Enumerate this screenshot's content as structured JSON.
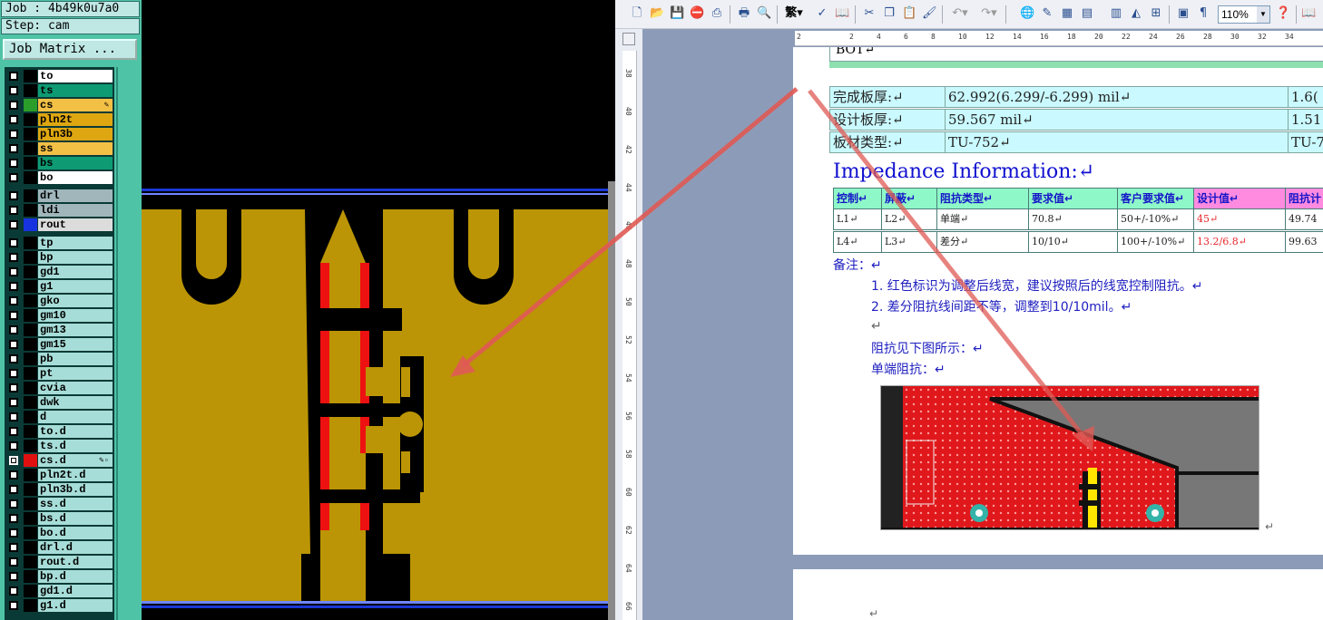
{
  "cam": {
    "job_label": "Job : 4b49k0u7a0",
    "step_label": "Step: cam",
    "job_matrix_button": "Job Matrix ...",
    "layers_group1": [
      {
        "name": "to",
        "color": "#ffffff",
        "swatch": "#000000",
        "checked": false
      },
      {
        "name": "ts",
        "color": "#0e9b74",
        "swatch": "#000000",
        "checked": false
      },
      {
        "name": "cs",
        "color": "#f3c046",
        "swatch": "#2a9d2a",
        "checked": false,
        "marker": "✎"
      },
      {
        "name": "pln2t",
        "color": "#dea712",
        "swatch": "#000000",
        "checked": false
      },
      {
        "name": "pln3b",
        "color": "#dea712",
        "swatch": "#000000",
        "checked": false
      },
      {
        "name": "ss",
        "color": "#f3c046",
        "swatch": "#000000",
        "checked": false
      },
      {
        "name": "bs",
        "color": "#0e9b74",
        "swatch": "#000000",
        "checked": false
      },
      {
        "name": "bo",
        "color": "#ffffff",
        "swatch": "#000000",
        "checked": false
      }
    ],
    "layers_group2": [
      {
        "name": "drl",
        "color": "#a0b6bb",
        "swatch": "#000000",
        "checked": false
      },
      {
        "name": "ldi",
        "color": "#a0b6bb",
        "swatch": "#000000",
        "checked": false
      },
      {
        "name": "rout",
        "color": "#dcdcdc",
        "swatch": "#1733e0",
        "checked": false
      }
    ],
    "layers_group3": [
      {
        "name": "tp",
        "swatch": "#000000",
        "checked": false
      },
      {
        "name": "bp",
        "swatch": "#000000",
        "checked": false
      },
      {
        "name": "gd1",
        "swatch": "#000000",
        "checked": false
      },
      {
        "name": "g1",
        "swatch": "#000000",
        "checked": false
      },
      {
        "name": "gko",
        "swatch": "#000000",
        "checked": false
      },
      {
        "name": "gm10",
        "swatch": "#000000",
        "checked": false
      },
      {
        "name": "gm13",
        "swatch": "#000000",
        "checked": false
      },
      {
        "name": "gm15",
        "swatch": "#000000",
        "checked": false
      },
      {
        "name": "pb",
        "swatch": "#000000",
        "checked": false
      },
      {
        "name": "pt",
        "swatch": "#000000",
        "checked": false
      },
      {
        "name": "cvia",
        "swatch": "#000000",
        "checked": false
      },
      {
        "name": "dwk",
        "swatch": "#000000",
        "checked": false
      },
      {
        "name": "d",
        "swatch": "#000000",
        "checked": false
      },
      {
        "name": "to.d",
        "swatch": "#000000",
        "checked": false
      },
      {
        "name": "ts.d",
        "swatch": "#000000",
        "checked": false
      },
      {
        "name": "cs.d",
        "swatch": "#e01010",
        "checked": true,
        "marker": "✎▫"
      },
      {
        "name": "pln2t.d",
        "swatch": "#000000",
        "checked": false
      },
      {
        "name": "pln3b.d",
        "swatch": "#000000",
        "checked": false
      },
      {
        "name": "ss.d",
        "swatch": "#000000",
        "checked": false
      },
      {
        "name": "bs.d",
        "swatch": "#000000",
        "checked": false
      },
      {
        "name": "bo.d",
        "swatch": "#000000",
        "checked": false
      },
      {
        "name": "drl.d",
        "swatch": "#000000",
        "checked": false
      },
      {
        "name": "rout.d",
        "swatch": "#000000",
        "checked": false
      },
      {
        "name": "bp.d",
        "swatch": "#000000",
        "checked": false
      },
      {
        "name": "gd1.d",
        "swatch": "#000000",
        "checked": false
      },
      {
        "name": "g1.d",
        "swatch": "#000000",
        "checked": false
      }
    ],
    "colors": {
      "copper": "#bb9505",
      "trace_edge": "#ee1111",
      "board_edge": "#1a38d6"
    }
  },
  "word": {
    "zoom": "110%",
    "ruler_marks": [
      "2",
      "2",
      "4",
      "6",
      "8",
      "10",
      "12",
      "14",
      "16",
      "18",
      "20",
      "22",
      "24",
      "26",
      "28",
      "30",
      "32",
      "34"
    ],
    "vruler_marks": [
      "38",
      "40",
      "42",
      "44",
      "46",
      "48",
      "50",
      "52",
      "54",
      "56",
      "58",
      "60",
      "62",
      "64",
      "66"
    ],
    "header_fragment": "BOT↵",
    "thickness_rows": [
      {
        "label": "完成板厚:↵",
        "value": "62.992(6.299/-6.299) mil↵",
        "extra": "1.6("
      },
      {
        "label": "设计板厚:↵",
        "value": "59.567 mil↵",
        "extra": "1.51"
      },
      {
        "label": "板材类型:↵",
        "value": "TU-752↵",
        "extra": "TU-7"
      }
    ],
    "impedance_title": "Impedance Information:↵",
    "impedance_headers": [
      "控制↵",
      "屏蔽↵",
      "阻抗类型↵",
      "要求值↵",
      "客户要求值↵",
      "设计值↵",
      "阻抗计"
    ],
    "impedance_rows": [
      [
        "L1↵",
        "L2↵",
        "单端↵",
        "70.8↵",
        "50+/-10%↵",
        "45↵",
        "49.74"
      ],
      [
        "L4↵",
        "L3↵",
        "差分↵",
        "10/10↵",
        "100+/-10%↵",
        "13.2/6.8↵",
        "99.63"
      ]
    ],
    "note_title": "备注：↵",
    "note_items": [
      "1.  红色标识为调整后线宽，建议按照后的线宽控制阻抗。↵",
      "2.  差分阻抗线间距不等，调整到10/10mil。↵"
    ],
    "blank_mark": "↵",
    "see_figure": "阻抗见下图所示：↵",
    "single_ended": "单端阻抗：↵",
    "figure_end_mark": "↵",
    "page2_mark": "↵",
    "colors": {
      "table_bg": "#cafaff",
      "header_green": "#8ff8c8",
      "header_pink": "#ff8be0",
      "highlight_red": "#e8262a",
      "title_blue": "#1010d0"
    }
  },
  "annotation": {
    "arrow_color": "#e05a55"
  },
  "toolbar_icons": [
    "new-doc",
    "open-folder",
    "save",
    "permission",
    "print-preview-lock",
    "print",
    "print-preview",
    "simplified-traditional",
    "spell-check",
    "research",
    "cut",
    "copy",
    "paste",
    "format-painter",
    "undo",
    "redo",
    "hyperlink",
    "tables-borders",
    "insert-table",
    "insert-excel",
    "columns",
    "drawing",
    "document-map",
    "show-hide",
    "help",
    "reading-mode"
  ]
}
